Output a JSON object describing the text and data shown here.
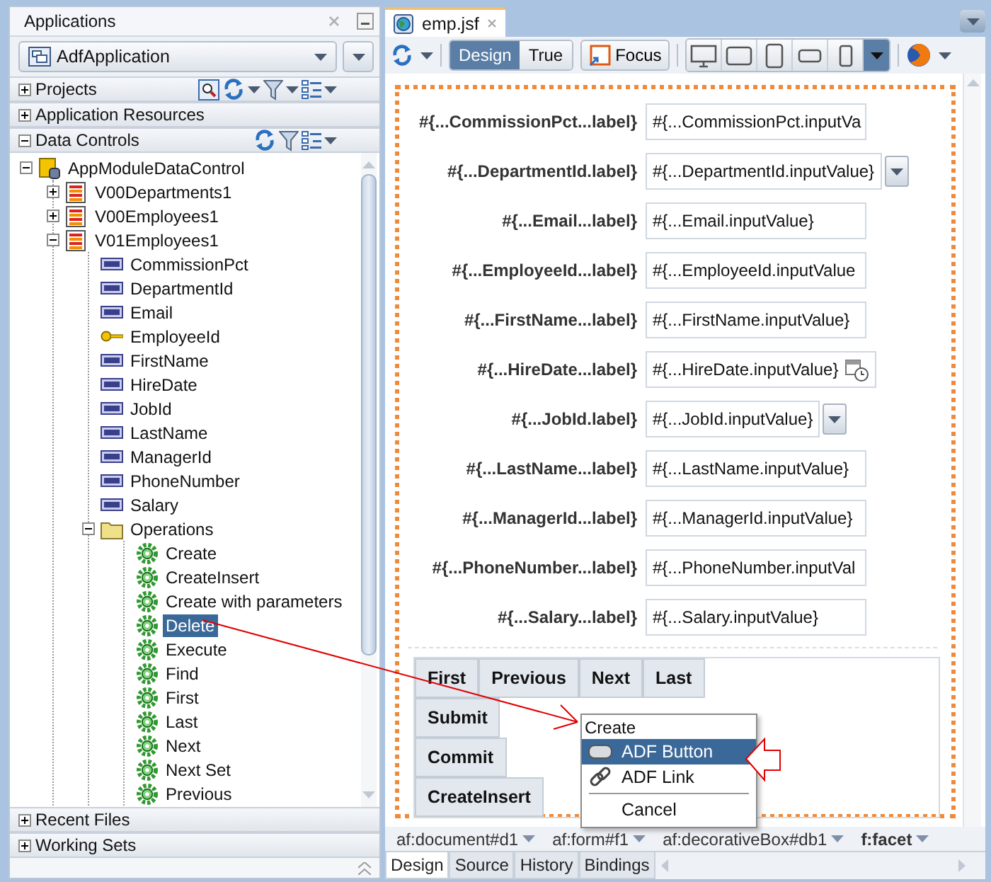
{
  "applications_panel": {
    "title": "Applications",
    "application": "AdfApplication",
    "sections": [
      {
        "label": "Projects",
        "expanded": false
      },
      {
        "label": "Application Resources",
        "expanded": false
      },
      {
        "label": "Data Controls",
        "expanded": true
      }
    ],
    "tree": [
      {
        "label": "AppModuleDataControl",
        "kind": "datacontrol",
        "expanded": true,
        "selected": false,
        "children": [
          {
            "label": "V00Departments1",
            "kind": "collection",
            "expanded": false,
            "selected": false
          },
          {
            "label": "V00Employees1",
            "kind": "collection",
            "expanded": false,
            "selected": false
          },
          {
            "label": "V01Employees1",
            "kind": "collection",
            "expanded": true,
            "selected": false,
            "children": [
              {
                "label": "CommissionPct",
                "kind": "attribute",
                "selected": false
              },
              {
                "label": "DepartmentId",
                "kind": "attribute",
                "selected": false
              },
              {
                "label": "Email",
                "kind": "attribute",
                "selected": false
              },
              {
                "label": "EmployeeId",
                "kind": "key",
                "selected": false
              },
              {
                "label": "FirstName",
                "kind": "attribute",
                "selected": false
              },
              {
                "label": "HireDate",
                "kind": "attribute",
                "selected": false
              },
              {
                "label": "JobId",
                "kind": "attribute",
                "selected": false
              },
              {
                "label": "LastName",
                "kind": "attribute",
                "selected": false
              },
              {
                "label": "ManagerId",
                "kind": "attribute",
                "selected": false
              },
              {
                "label": "PhoneNumber",
                "kind": "attribute",
                "selected": false
              },
              {
                "label": "Salary",
                "kind": "attribute",
                "selected": false
              },
              {
                "label": "Operations",
                "kind": "folder",
                "expanded": true,
                "selected": false,
                "children": [
                  {
                    "label": "Create",
                    "kind": "operation",
                    "selected": false
                  },
                  {
                    "label": "CreateInsert",
                    "kind": "operation",
                    "selected": false
                  },
                  {
                    "label": "Create with parameters",
                    "kind": "operation",
                    "selected": false
                  },
                  {
                    "label": "Delete",
                    "kind": "operation",
                    "selected": true
                  },
                  {
                    "label": "Execute",
                    "kind": "operation",
                    "selected": false
                  },
                  {
                    "label": "Find",
                    "kind": "operation",
                    "selected": false
                  },
                  {
                    "label": "First",
                    "kind": "operation",
                    "selected": false
                  },
                  {
                    "label": "Last",
                    "kind": "operation",
                    "selected": false
                  },
                  {
                    "label": "Next",
                    "kind": "operation",
                    "selected": false
                  },
                  {
                    "label": "Next Set",
                    "kind": "operation",
                    "selected": false
                  },
                  {
                    "label": "Previous",
                    "kind": "operation",
                    "selected": false
                  }
                ]
              }
            ]
          }
        ]
      }
    ],
    "bottom_sections": [
      {
        "label": "Recent Files",
        "expanded": false
      },
      {
        "label": "Working Sets",
        "expanded": false
      }
    ]
  },
  "editor": {
    "tab": "emp.jsf",
    "modes": [
      {
        "label": "Design",
        "selected": true
      },
      {
        "label": "True",
        "selected": false
      }
    ],
    "focus_button": "Focus",
    "form_fields": [
      {
        "label": "#{...CommissionPct...label}",
        "value": "#{...CommissionPct.inputVa",
        "kind": "text"
      },
      {
        "label": "#{...DepartmentId.label}",
        "value": "#{...DepartmentId.inputValue}",
        "kind": "choice"
      },
      {
        "label": "#{...Email...label}",
        "value": "#{...Email.inputValue}",
        "kind": "text"
      },
      {
        "label": "#{...EmployeeId...label}",
        "value": "#{...EmployeeId.inputValue",
        "kind": "text"
      },
      {
        "label": "#{...FirstName...label}",
        "value": "#{...FirstName.inputValue}",
        "kind": "text"
      },
      {
        "label": "#{...HireDate...label}",
        "value": "#{...HireDate.inputValue}",
        "kind": "date"
      },
      {
        "label": "#{...JobId.label}",
        "value": "#{...JobId.inputValue}",
        "kind": "choice"
      },
      {
        "label": "#{...LastName...label}",
        "value": "#{...LastName.inputValue}",
        "kind": "text"
      },
      {
        "label": "#{...ManagerId...label}",
        "value": "#{...ManagerId.inputValue}",
        "kind": "text"
      },
      {
        "label": "#{...PhoneNumber...label}",
        "value": "#{...PhoneNumber.inputVal",
        "kind": "text"
      },
      {
        "label": "#{...Salary...label}",
        "value": "#{...Salary.inputValue}",
        "kind": "text"
      }
    ],
    "button_rows": [
      [
        "First",
        "Previous",
        "Next",
        "Last"
      ],
      [
        "Submit"
      ],
      [
        "Commit"
      ],
      [
        "CreateInsert"
      ]
    ],
    "breadcrumbs": [
      {
        "label": "af:document#d1",
        "selected": false
      },
      {
        "label": "af:form#f1",
        "selected": false
      },
      {
        "label": "af:decorativeBox#db1",
        "selected": false
      },
      {
        "label": "f:facet",
        "selected": true
      }
    ],
    "bottom_tabs": [
      {
        "label": "Design",
        "selected": true
      },
      {
        "label": "Source",
        "selected": false
      },
      {
        "label": "History",
        "selected": false
      },
      {
        "label": "Bindings",
        "selected": false
      }
    ]
  },
  "context_menu": {
    "title": "Create",
    "items": [
      {
        "label": "ADF Button",
        "kind": "button",
        "selected": true,
        "separator_before": false
      },
      {
        "label": "ADF Link",
        "kind": "link",
        "selected": false,
        "separator_before": false
      },
      {
        "label": "Cancel",
        "kind": "plain",
        "selected": false,
        "separator_before": true
      }
    ]
  }
}
